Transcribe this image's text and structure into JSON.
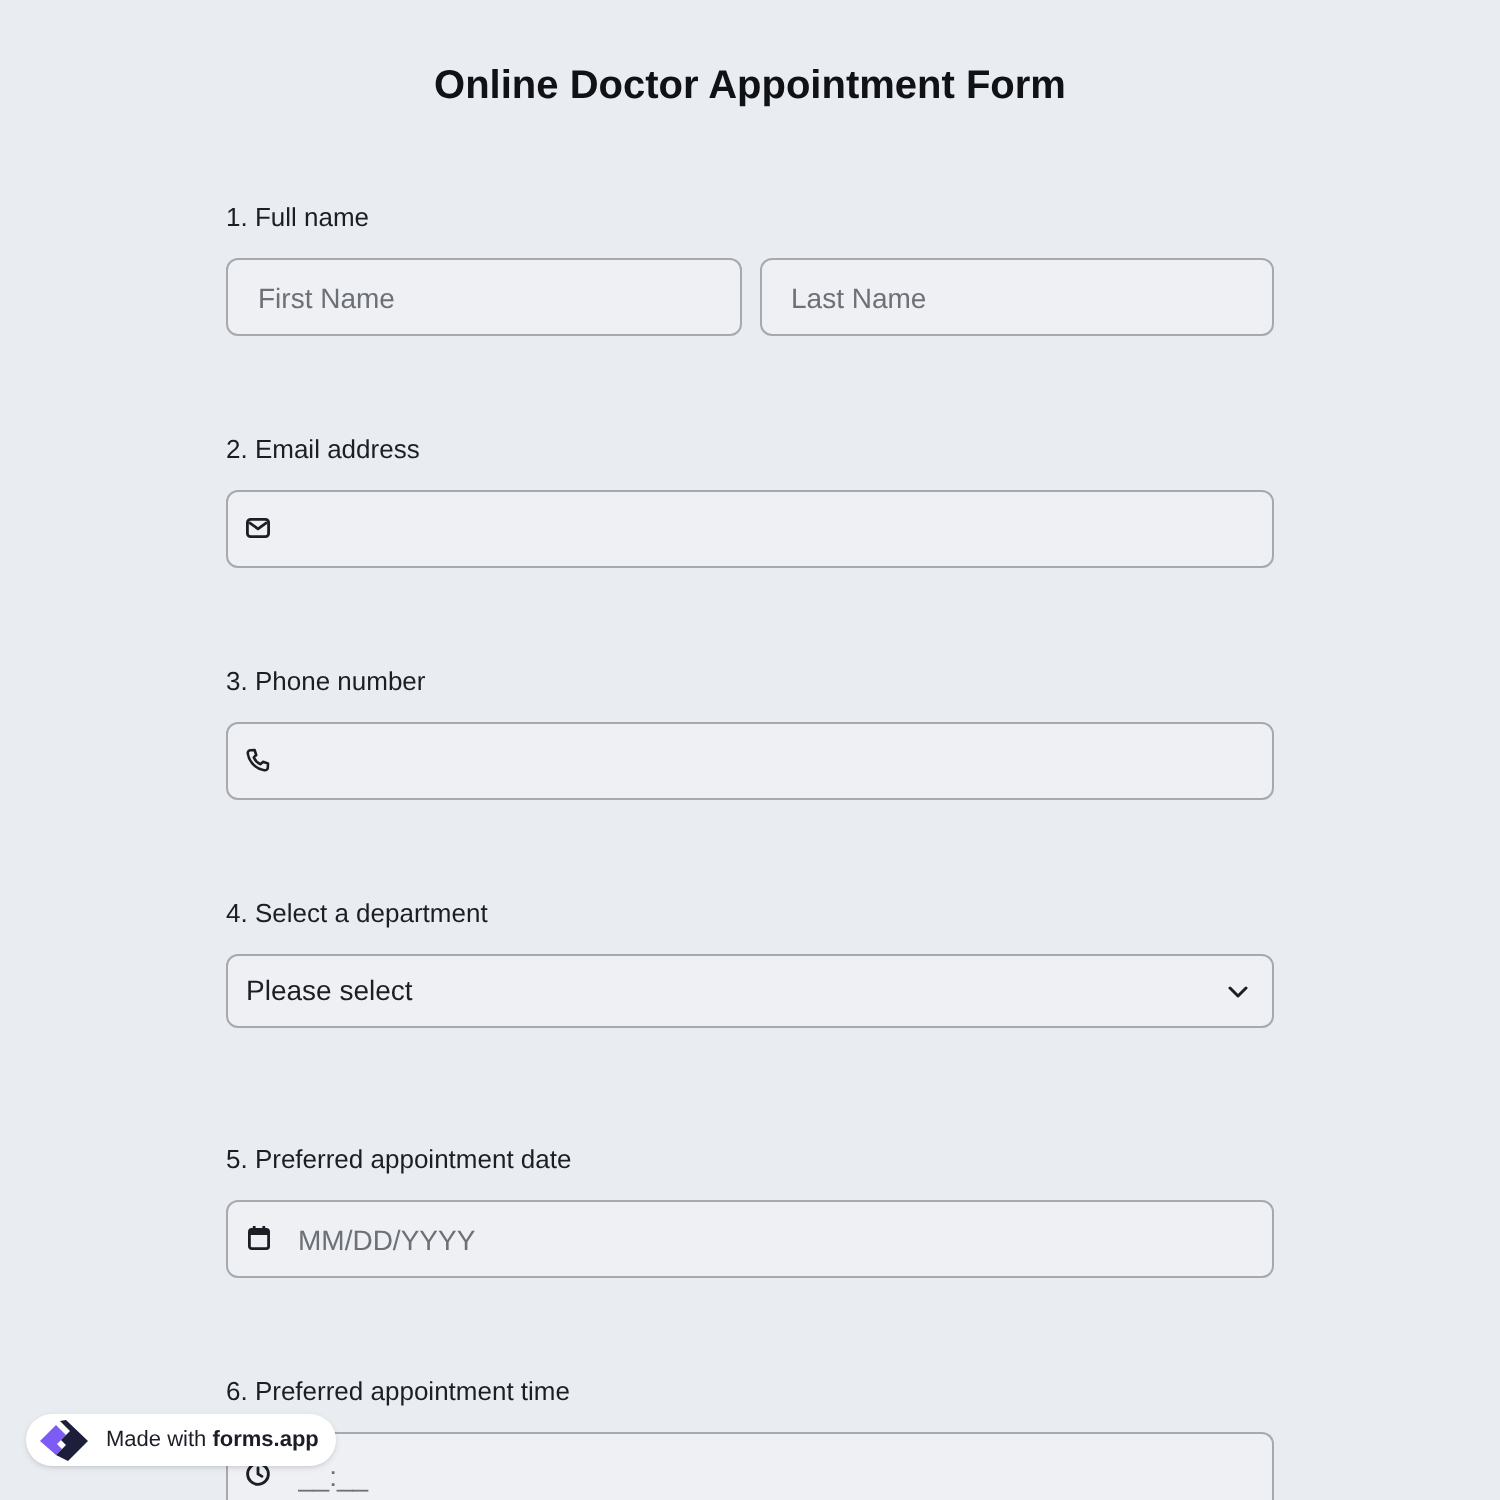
{
  "title": "Online Doctor Appointment Form",
  "questions": [
    {
      "label": "1. Full name",
      "kind": "name",
      "fields": [
        {
          "placeholder": "First Name"
        },
        {
          "placeholder": "Last Name"
        }
      ]
    },
    {
      "label": "2. Email address",
      "kind": "email"
    },
    {
      "label": "3. Phone number",
      "kind": "phone"
    },
    {
      "label": "4. Select a department",
      "kind": "select",
      "value": "Please select"
    },
    {
      "label": "5. Preferred appointment date",
      "kind": "date",
      "placeholder": "MM/DD/YYYY"
    },
    {
      "label": "6. Preferred appointment time",
      "kind": "time",
      "placeholder": "__:__"
    }
  ],
  "badge": {
    "text": "Made with **forms.app**"
  }
}
